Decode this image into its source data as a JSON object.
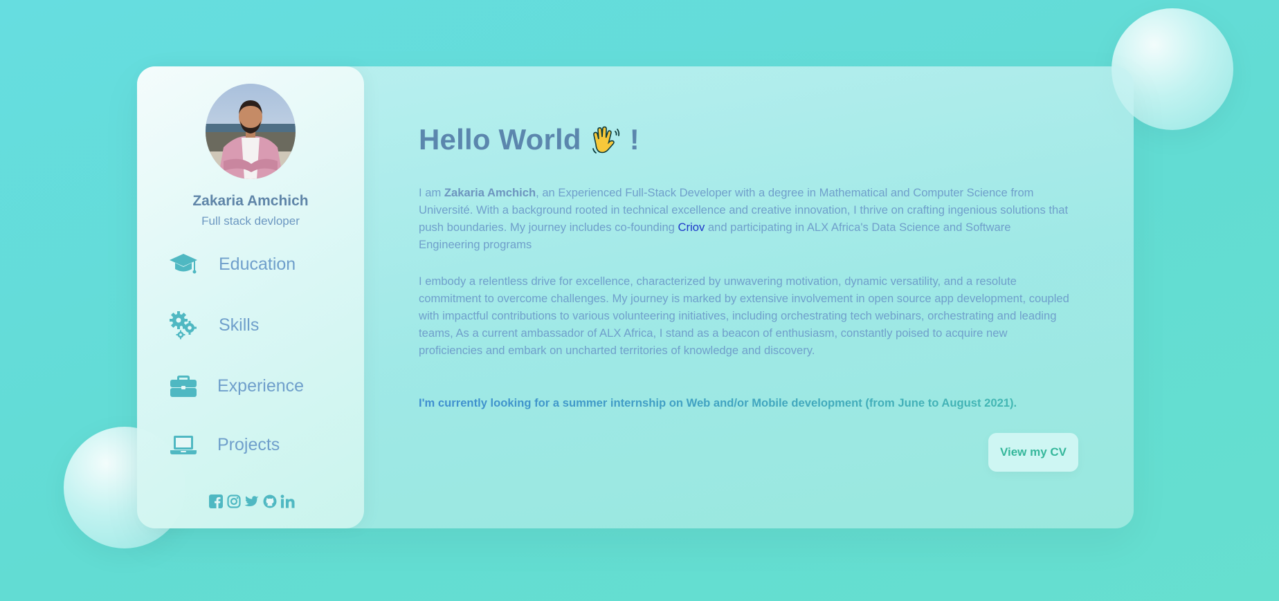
{
  "profile": {
    "name": "Zakaria Amchich",
    "role": "Full stack devloper"
  },
  "nav": {
    "items": [
      {
        "label": "Education",
        "icon": "graduation-cap-icon"
      },
      {
        "label": "Skills",
        "icon": "gears-icon"
      },
      {
        "label": "Experience",
        "icon": "briefcase-icon"
      },
      {
        "label": "Projects",
        "icon": "laptop-icon"
      }
    ]
  },
  "social": [
    "facebook-icon",
    "instagram-icon",
    "twitter-icon",
    "github-icon",
    "linkedin-icon"
  ],
  "main": {
    "heading": "Hello World",
    "heading_emoji": "👏",
    "heading_suffix": "!",
    "intro": {
      "prefix": "I am ",
      "name": "Zakaria Amchich",
      "middle": ", an Experienced Full-Stack Developer with a degree in Mathematical and Computer Science from Université. With a background rooted in technical excellence and creative innovation, I thrive on crafting ingenious solutions that push boundaries. My journey includes co-founding ",
      "link": "Criov",
      "suffix": " and participating in ALX Africa's Data Science and Software Engineering programs"
    },
    "paragraph2": "I embody a relentless drive for excellence, characterized by unwavering motivation, dynamic versatility, and a resolute commitment to overcome challenges. My journey is marked by extensive involvement in open source app development, coupled with impactful contributions to various volunteering initiatives, including orchestrating tech webinars, orchestrating and leading teams, As a current ambassador of ALX Africa, I stand as a beacon of enthusiasm, constantly poised to acquire new proficiencies and embark on uncharted territories of knowledge and discovery.",
    "cta": "I'm currently looking for a summer internship on Web and/or Mobile development (from June to August 2021).",
    "cv_button": "View my CV"
  },
  "colors": {
    "accent": "#4fb8c2",
    "text": "#6f9fcb",
    "heading": "#5b86ad",
    "link": "#1d36c9",
    "button_text": "#35b79b"
  }
}
